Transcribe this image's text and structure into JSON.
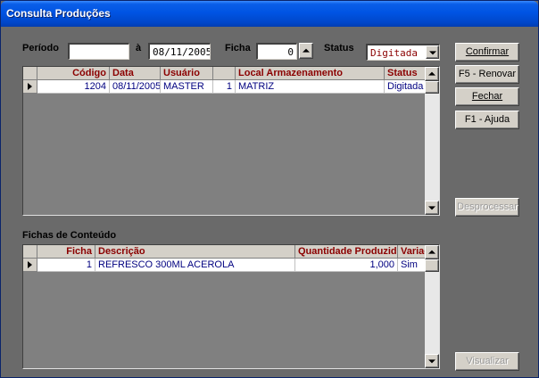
{
  "window": {
    "title": "Consulta Produções"
  },
  "filters": {
    "periodo_label": "Período",
    "periodo_start": "",
    "a_label": "à",
    "periodo_end": "08/11/2005",
    "ficha_label": "Ficha",
    "ficha_value": "0",
    "status_label": "Status",
    "status_value": "Digitada"
  },
  "buttons": {
    "confirmar": "Confirmar",
    "renovar": "F5 - Renovar",
    "fechar": "Fechar",
    "ajuda": "F1 - Ajuda",
    "desprocessar": "Desprocessar",
    "visualizar": "Visualizar"
  },
  "producoes": {
    "columns": [
      "Código",
      "Data",
      "Usuário",
      "",
      "Local Armazenamento",
      "Status"
    ],
    "rows": [
      [
        "1204",
        "08/11/2005",
        "MASTER",
        "1",
        "MATRIZ",
        "Digitada"
      ]
    ]
  },
  "fichas": {
    "section_label": "Fichas de Conteúdo",
    "columns": [
      "Ficha",
      "Descrição",
      "Quantidade Produzida",
      "Variações"
    ],
    "rows": [
      [
        "1",
        "REFRESCO 300ML ACEROLA",
        "1,000",
        "Sim"
      ]
    ]
  },
  "colors": {
    "header_text": "#8b0000",
    "cell_text": "#000080",
    "grid_bg": "#808080",
    "form_bg": "#6a6a6a",
    "titlebar": "#0054e3"
  }
}
